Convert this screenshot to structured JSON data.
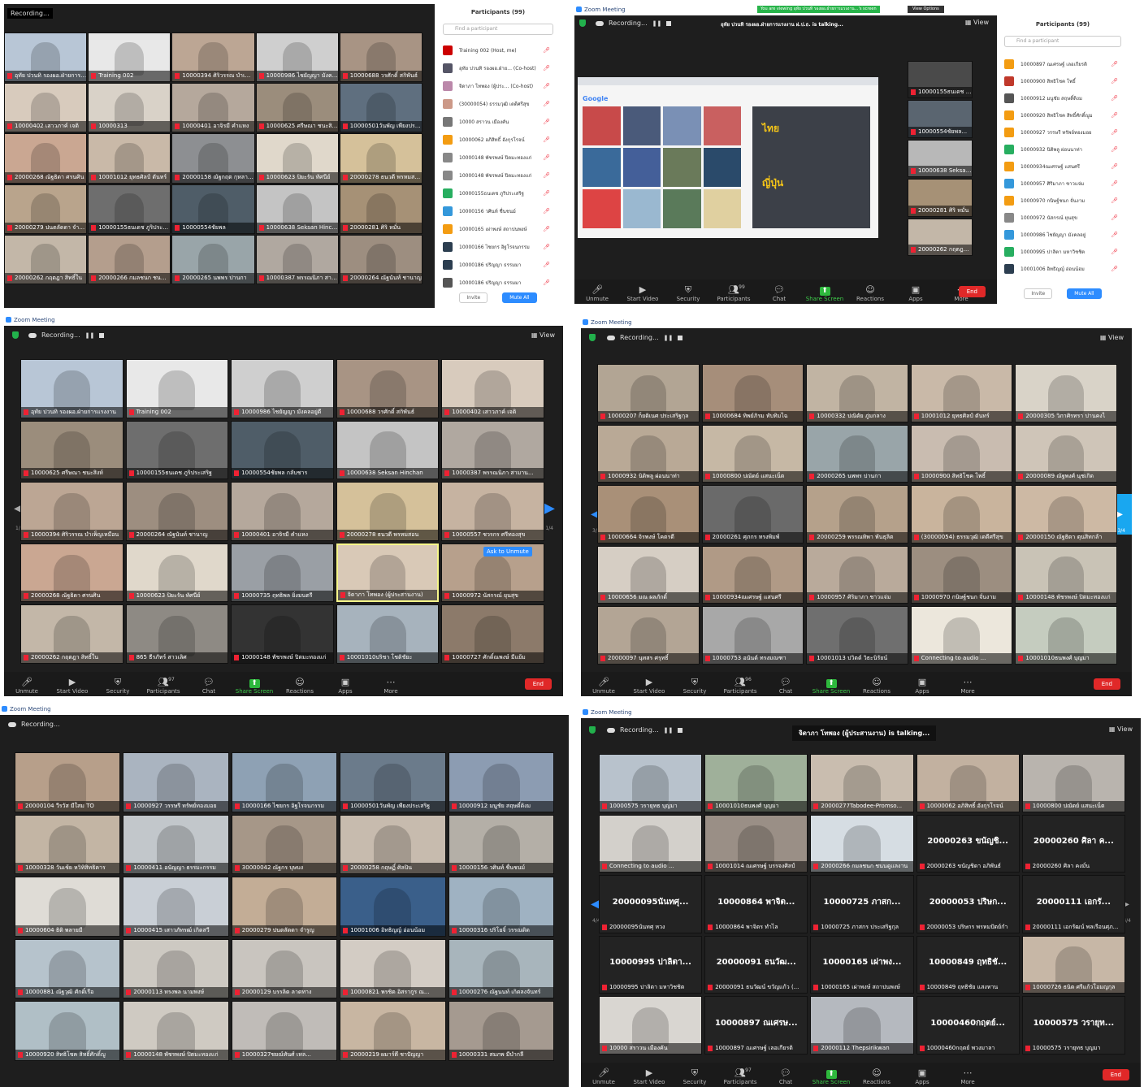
{
  "p1": {
    "recording": "Recording...",
    "participants_title": "Participants (99)",
    "search_placeholder": "Find a participant",
    "invite": "Invite",
    "mute_all": "Mute All",
    "tiles": [
      {
        "n": "อุทัย ปวนทิ รองผอ.ฝ่ายการแรงงาน",
        "c": "#b8c6d6"
      },
      {
        "n": "Training 002",
        "c": "#e8e8e8"
      },
      {
        "n": "10000394 ศิริวรรณ บำเพ็ญเหมือน",
        "c": "#bca694"
      },
      {
        "n": "10000986 ไชยัญญา มังคลอยู่ดี",
        "c": "#cfcfcf"
      },
      {
        "n": "10000688 วรศักดิ์ สกิพันธ์",
        "c": "#a89484"
      },
      {
        "n": "10000402 เสาวภาค์ เจติ",
        "c": "#d8cbbd"
      },
      {
        "n": "10000313",
        "c": "#d9d2c8"
      },
      {
        "n": "10000401 อาจิรมี คำแหง",
        "c": "#b5a89c"
      },
      {
        "n": "10000625 ศรีษณา ชนะสิงห์",
        "c": "#9b8d7c"
      },
      {
        "n": "10000501วันพัญ เพียงประเสริฐ",
        "c": "#5f6f7f"
      },
      {
        "n": "20000268 ณัฐธิดา ศรนศิน",
        "c": "#caa792"
      },
      {
        "n": "10001012 ยุทธศิลป์ ตันทร์",
        "c": "#c9b9a8"
      },
      {
        "n": "20000158 ณัฐกฤต กุหลาบทอง",
        "c": "#8d8f92"
      },
      {
        "n": "10000623 ปิยะรัน ทัศนีย์",
        "c": "#e0d8cb"
      },
      {
        "n": "20000278 ธนวดี พรหมสอน",
        "c": "#d5c19a"
      },
      {
        "n": "20000279 ปนตลัดดา จำรูญ",
        "c": "#b9a48c"
      },
      {
        "n": "10000155ธนเดช ภูริประเสริฐ",
        "c": "#6e6e6e"
      },
      {
        "n": "10000554ชัยพล",
        "c": "#4f5d68"
      },
      {
        "n": "10000638 Seksan Hinchan",
        "c": "#c4c4c4"
      },
      {
        "n": "20000281 ศิริ หมั่น",
        "c": "#a69176"
      },
      {
        "n": "20000262 กฤตฎา สิทธิ์ใน",
        "c": "#c3b7a8"
      },
      {
        "n": "20000266 กมลชนก ชนนดูแลงาน",
        "c": "#b49e8d"
      },
      {
        "n": "20000265 นพพร ปานกา",
        "c": "#99a5a9"
      },
      {
        "n": "10000387 พรรณนิภา สามาน",
        "c": "#b0a8a0"
      },
      {
        "n": "20000264 ณัฐนันท์ ชานาญ",
        "c": "#9d8e80"
      }
    ],
    "plist": [
      {
        "n": "Training 002 (Host, me)",
        "c": "#c00"
      },
      {
        "n": "อุทัย ปวนทิ รองผอ.ฝ่าย... (Co-host)",
        "c": "#556"
      },
      {
        "n": "จิดาภา โทพอง (ผู้ประ... (Co-host)",
        "c": "#b8a"
      },
      {
        "n": "(30000054) ธรรมวุฒิ เดดีศรีสุข",
        "c": "#c98"
      },
      {
        "n": "10000 สราวน เมืองคัน",
        "c": "#777"
      },
      {
        "n": "10000062 อภิสิทธิ์ อังกุรโรจน์",
        "c": "#f39c12"
      },
      {
        "n": "10000148 พัชรพงษ์ ปิตมะทองแก่",
        "c": "#888"
      },
      {
        "n": "10000148 พัชรพงษ์ ปิตมะทองแก่",
        "c": "#888"
      },
      {
        "n": "10000155ธนเดช ภูริประเสริฐ",
        "c": "#27ae60"
      },
      {
        "n": "10000156 วศินท์ ชื่นชนม์",
        "c": "#3498db"
      },
      {
        "n": "10000165 เผ่าพงษ์ สถาปนพงษ์",
        "c": "#f39c12"
      },
      {
        "n": "10000166 ไชยกร อิฐโรจนกรรม",
        "c": "#2c3e50"
      },
      {
        "n": "10000186 ปริญญา ธรรมมา",
        "c": "#2c3e50"
      },
      {
        "n": "10000186 ปริญญา ธรรมมา",
        "c": "#555"
      }
    ]
  },
  "p2": {
    "title": "Zoom Meeting",
    "banner": "You are viewing อุทัย ปวนทิ รองผอ.ฝ่ายการแรงงาน...'s screen",
    "view_options": "View Options",
    "talking": "อุทัย ปวนทิ รองผอ.ฝ่ายการแรงงาน ฝ.ป.ธ. is talking...",
    "recording": "Recording...",
    "participants_title": "Participants (99)",
    "search_placeholder": "Find a participant",
    "invite": "Invite",
    "mute_all": "Mute All",
    "view": "View",
    "google": "Google",
    "thai_label": "ไทย",
    "japan_label": "ญี่ปุ่น",
    "side_tiles": [
      {
        "n": "10000155ธนเดช ภูริ...",
        "c": "#4a4a4a"
      },
      {
        "n": "10000554ชัยพล...",
        "c": "#5a6570"
      },
      {
        "n": "10000638 Seksan Hin...",
        "c": "#b8b8b8"
      },
      {
        "n": "20000281 ศิริ หมั่น",
        "c": "#a69176"
      },
      {
        "n": "20000262 กฤตฎา สิทธิ์",
        "c": "#c3b7a8"
      }
    ],
    "plist": [
      {
        "n": "10000897 ณเศรษฐ์ เลอเกียรติ",
        "c": "#f39c12"
      },
      {
        "n": "10000900 สิทธิโชค โพธิ์",
        "c": "#c0392b"
      },
      {
        "n": "10000912 มนูชัย สฤษดิ์ดิงม",
        "c": "#555"
      },
      {
        "n": "10000920 สิทธิโชค สิทธิ์ศักดิ์ญูม",
        "c": "#f39c12"
      },
      {
        "n": "10000927 วรรษรี ทรัพย์ทองมอย",
        "c": "#f39c12"
      },
      {
        "n": "10000932 นิติพลู ผ่อนนาท่า",
        "c": "#27ae60"
      },
      {
        "n": "10000934ณเศรษฐ์ แสนศรี",
        "c": "#f39c12"
      },
      {
        "n": "10000957 ศิริมาภา ชาวแจ่ม",
        "c": "#3498db"
      },
      {
        "n": "10000970 กนิษฐ์ชนก จั่นงาม",
        "c": "#f39c12"
      },
      {
        "n": "10000972 นัสกรณ์ ยุนสุข",
        "c": "#888"
      },
      {
        "n": "10000986 ไชยัญญา มังคลอยู่",
        "c": "#3498db"
      },
      {
        "n": "10000995 ปาลิตา มหาวิชชิต",
        "c": "#27ae60"
      },
      {
        "n": "10001006 อิทธิญญ์ อ่อนน้อม",
        "c": "#2c3e50"
      }
    ],
    "controls": [
      "Unmute",
      "Start Video",
      "Security",
      "Participants",
      "Chat",
      "Share Screen",
      "Reactions",
      "Apps",
      "More"
    ],
    "count": "99",
    "end": "End"
  },
  "p3": {
    "title": "Zoom Meeting",
    "recording": "Recording...",
    "view": "View",
    "page": "1/4",
    "page_r": "1/4",
    "ask_unmute": "Ask to Unmute",
    "count": "97",
    "end": "End",
    "controls": [
      "Unmute",
      "Start Video",
      "Security",
      "Participants",
      "Chat",
      "Share Screen",
      "Reactions",
      "Apps",
      "More"
    ],
    "tiles": [
      {
        "n": "อุทัย ปวนทิ รองผอ.ฝ่ายการแรงงาน",
        "c": "#b8c6d6"
      },
      {
        "n": "Training 002",
        "c": "#e8e8e8"
      },
      {
        "n": "10000986 ไชยัญญา มังคลอยู่ดี",
        "c": "#cfcfcf"
      },
      {
        "n": "10000688 วรศักดิ์ สกิพันธ์",
        "c": "#a89484"
      },
      {
        "n": "10000402 เสาวภาค์ เจติ",
        "c": "#d8cbbd"
      },
      {
        "n": "10000625 ศรีษณา ชนะสิงห์",
        "c": "#9b8d7c"
      },
      {
        "n": "10000155ธนเดช ภูริประเสริฐ",
        "c": "#6e6e6e"
      },
      {
        "n": "10000554ชัยพล กลับชาร",
        "c": "#4f5d68"
      },
      {
        "n": "10000638 Seksan Hinchan",
        "c": "#c4c4c4"
      },
      {
        "n": "10000387 พรรณนิภา สามาน...",
        "c": "#b0a8a0"
      },
      {
        "n": "10000394 ศิริวรรณ บำเพ็ญเหมือน",
        "c": "#bca694"
      },
      {
        "n": "20000264 ณัฐนันท์ ชานาญ",
        "c": "#9d8e80"
      },
      {
        "n": "10000401 อาจิรมี คำแหง",
        "c": "#b5a89c"
      },
      {
        "n": "20000278 ธนวดี พรหมสอน",
        "c": "#d5c19a"
      },
      {
        "n": "10000557 ชวรกร ศรีทองสุข",
        "c": "#c6b3a1"
      },
      {
        "n": "20000268 ณัฐธิดา ศรนศิน",
        "c": "#caa792"
      },
      {
        "n": "10000623 ปิยะรัน ทัศนีย์",
        "c": "#e0d8cb"
      },
      {
        "n": "10000735 ฤทธิพล ยิ่งมนตรี",
        "c": "#9a9fa5"
      },
      {
        "n": "จิดาภา โทพอง (ผู้ประสานงาน)",
        "c": "#d9c9b7",
        "hl": true
      },
      {
        "n": "10000972 นัสกรณ์ ยุนสุข",
        "c": "#b7a08c"
      },
      {
        "n": "20000262 กฤตฎา สิทธิ์ใน",
        "c": "#c3b7a8"
      },
      {
        "n": "865 ธีรภัทร์ สาวเลิศ",
        "c": "#8e8a84"
      },
      {
        "n": "10000148 พัชรพงษ์ ปิตมะทองแก่",
        "c": "#333"
      },
      {
        "n": "10001010ปริชา โชติชัยะ",
        "c": "#a7b3bd"
      },
      {
        "n": "10000727 ศักดิ์ณพงษ์ มีแย้ม",
        "c": "#8c7a6a"
      }
    ]
  },
  "p4": {
    "title": "Zoom Meeting",
    "recording": "Recording...",
    "view": "View",
    "page": "3/4",
    "page_r": "3/4",
    "count": "96",
    "end": "End",
    "controls": [
      "Unmute",
      "Start Video",
      "Security",
      "Participants",
      "Chat",
      "Share Screen",
      "Reactions",
      "Apps",
      "More"
    ],
    "tiles": [
      {
        "n": "10000207 ก็ยติเนศ ประเสริฐกุล",
        "c": "#b2a594"
      },
      {
        "n": "10000684 ทิพย์ภิรม ทับทิมไฉ",
        "c": "#a68e7a"
      },
      {
        "n": "10000332 ปณิดัย ภู่มกลาง",
        "c": "#c1b4a3"
      },
      {
        "n": "10001012 ยุทธศิลป์ ตันทร์",
        "c": "#c9b9a8"
      },
      {
        "n": "20000305 วิภาศิรทรา ปานคงไ",
        "c": "#d9d3c8"
      },
      {
        "n": "10000932 นิติพลู ผ่อนนาท่า",
        "c": "#b9a996"
      },
      {
        "n": "10000800 ปณัดย์ แสนะเน็ต",
        "c": "#c6b8a5"
      },
      {
        "n": "20000265 นพพร ปานกา",
        "c": "#99a5a9"
      },
      {
        "n": "10000900 สิทธิโชค โพธิ์",
        "c": "#c9bcb0"
      },
      {
        "n": "20000089 ณัฐพงศ์ นุชเกิด",
        "c": "#cfc5b8"
      },
      {
        "n": "10000664 จิรพงษ์ โคตรดี",
        "c": "#a99078"
      },
      {
        "n": "20000261 ศุภกร ทรงพิมพ์",
        "c": "#6a6a6a"
      },
      {
        "n": "20000259 พรรณทิพา พันธุลิต",
        "c": "#b5a18b"
      },
      {
        "n": "(30000054) ธรรมวุฒิ เดดีศรีสุข",
        "c": "#c9b49d"
      },
      {
        "n": "20000150 ณัฐธิดา ตุนสิทกล้า",
        "c": "#cdb9a4"
      },
      {
        "n": "10000656 มณ ผลภักดิ์",
        "c": "#d6cec4"
      },
      {
        "n": "10000934ณเศรษฐ์ แสนศรี",
        "c": "#b09a86"
      },
      {
        "n": "10000957 ศิริมาภา ชาวแจ่ม",
        "c": "#b9aa9b"
      },
      {
        "n": "10000970 กนิษฐ์ชนก จั่นงาม",
        "c": "#9c8e80"
      },
      {
        "n": "10000148 พัชรพงษ์ ปิตมะทองแก่",
        "c": "#c9c3b6"
      },
      {
        "n": "20000097 นุทสร ศรุทธิ์",
        "c": "#b3a595"
      },
      {
        "n": "10000753 อนันต์ ทรงมณฑา",
        "c": "#a8a8a8"
      },
      {
        "n": "10001013 ปวิตต์ วิธะนิรัยน์",
        "c": "#6f6f6f"
      },
      {
        "n": "Connecting to audio ...",
        "c": "#ece7dc"
      },
      {
        "n": "10001010ธนพงศ์ บุญมา",
        "c": "#c5ccbf"
      }
    ]
  },
  "p5": {
    "title": "Zoom Meeting",
    "recording": "Recording...",
    "tiles": [
      {
        "n": "20000104 วีรวัส มีใสม TO",
        "c": "#b79f8a"
      },
      {
        "n": "10000927 วรรษรี ทรัพย์ทองมอย",
        "c": "#aab4c0"
      },
      {
        "n": "10000166 ไชยกร อิฐโรจนกรรม",
        "c": "#8ea1b4"
      },
      {
        "n": "10000501วันพัญ เพียงประเสริฐ",
        "c": "#6b7b8b"
      },
      {
        "n": "10000912 มนูชัย สฤษดิ์ดิงม",
        "c": "#8c9cb2"
      },
      {
        "n": "10000328 วันเช้ย หวิทิสิทธิคาร",
        "c": "#c3b5a4"
      },
      {
        "n": "10000411 อนัญญา ธรรมะกรรม",
        "c": "#c2c7cb"
      },
      {
        "n": "30000042 ณัฐกร บุษบง",
        "c": "#a69788"
      },
      {
        "n": "20000258 กฤษฏิ์ ศิลปิน",
        "c": "#c7bbae"
      },
      {
        "n": "10000156 วศินท์ ชื่นชนม์",
        "c": "#b4afa7"
      },
      {
        "n": "10000604 ธิติ พลายมี",
        "c": "#dfdcd6"
      },
      {
        "n": "10000415 เสาวภัทรฒ์ เกิดสวี",
        "c": "#c9cfd6"
      },
      {
        "n": "20000279 ปนตลัดดา จำรูญ",
        "c": "#c3ad96"
      },
      {
        "n": "10001006 อิทธิญญ์ อ่อนน้อม",
        "c": "#3a5f8a"
      },
      {
        "n": "10000316 ปริโยจิ์ วรรณดิด",
        "c": "#9fb2c2"
      },
      {
        "n": "10000881 ณัฐวุฒิ ศักดิ์เรือ",
        "c": "#b6c3cc"
      },
      {
        "n": "20000113 ทรงพล นามพงษ์",
        "c": "#cdc9c2"
      },
      {
        "n": "20000129 บรรลิต ลาดทาง",
        "c": "#c9c5bf"
      },
      {
        "n": "10000821 พรชิต อิสรากูร ณ...",
        "c": "#d3ccc4"
      },
      {
        "n": "10000276 ณัฐนนท์ เกิดลงจันทร์",
        "c": "#a8b5bc"
      },
      {
        "n": "10000920 สิทธิโชค สิทธิ์ศักดิ์ญู",
        "c": "#b0bfc6"
      },
      {
        "n": "10000148 พัชรพงษ์ ปิตมะทองแก่",
        "c": "#cfcac2"
      },
      {
        "n": "10000327ชยณ์ทันศ์ เหล...",
        "c": "#c0bcb8"
      },
      {
        "n": "20000219 ผมาร์ตึ ชาปัญญา",
        "c": "#c8b6a2"
      },
      {
        "n": "10000331 สมภพ มีบำกลี",
        "c": "#a59a90"
      }
    ]
  },
  "p6": {
    "title": "Zoom Meeting",
    "recording": "Recording...",
    "talking": "จิดาภา โทพอง (ผู้ประสานงาน) is talking...",
    "view": "View",
    "page": "4/4",
    "page_r": "4/4",
    "count": "97",
    "end": "End",
    "controls": [
      "Unmute",
      "Start Video",
      "Security",
      "Participants",
      "Chat",
      "Share Screen",
      "Reactions",
      "Apps",
      "More"
    ],
    "tiles": [
      {
        "n": "10000575 วรายุทธ บุญมา",
        "c": "#b8c2cc",
        "v": 1
      },
      {
        "n": "10001010ธนพงศ์ บุญมา",
        "c": "#9fb09a",
        "v": 1
      },
      {
        "n": "20000277Tabodee-Promso...",
        "c": "#c9bdaf",
        "v": 1
      },
      {
        "n": "10000062 อภิสิทธิ์ อังกุรโรจน์",
        "c": "#c2b1a0",
        "v": 1
      },
      {
        "n": "10000800 ปณัดย์ แสนะเน็ต",
        "c": "#b9b4ae",
        "v": 1
      },
      {
        "n": "Connecting to audio ...",
        "c": "#d3d0cb",
        "v": 1
      },
      {
        "n": "10001014 ณเศรษฐ์ บรรจงศิลป์",
        "c": "#9a8f86",
        "v": 1
      },
      {
        "n": "20000266 กมลชนก ชนนดูแลงาน",
        "c": "#d6dde3",
        "v": 1
      },
      {
        "n": "20000263 ขนัญชิดา อภิพันธ์",
        "big": "20000263 ขนัญชิ...",
        "v": 0
      },
      {
        "n": "20000260 ศิลา คงมั่น",
        "big": "20000260 ศิลา ค...",
        "v": 0
      },
      {
        "n": "20000095นันทศุ หวง",
        "big": "20000095นันทศุ...",
        "v": 0
      },
      {
        "n": "10000864 พาจิตร ทำไล",
        "big": "10000864 พาจิต...",
        "v": 0
      },
      {
        "n": "10000725 ภาสกร ประเสริฐกุล",
        "big": "10000725 ภาสก...",
        "v": 0
      },
      {
        "n": "20000053 ปริษกร พรหมปัตย์กำ",
        "big": "20000053 ปริษก...",
        "v": 0
      },
      {
        "n": "20000111 เอกรัฒน์ พลเรือนศุภ...",
        "big": "20000111 เอกรั...",
        "v": 0
      },
      {
        "n": "10000995 ปาลิตา มหาวิชชิต",
        "big": "10000995 ปาลิตา...",
        "v": 0
      },
      {
        "n": "20000091 ธนวัฒน์ ขวัญแก้ว (...",
        "big": "20000091 ธนวัฒ...",
        "v": 0
      },
      {
        "n": "10000165 เผ่าพงษ์ สถาปนพงษ์",
        "big": "10000165 เผ่าพง...",
        "v": 0
      },
      {
        "n": "10000849 ฤทธิชัย แสงทาน",
        "big": "10000849 ฤทธิชั...",
        "v": 0
      },
      {
        "n": "10000726 ธนิต ศรีแก้วโอมญกุล",
        "c": "#c7b7a6",
        "v": 1
      },
      {
        "n": "10000 สราวน เมืองคัน",
        "c": "#d9d6d1",
        "v": 1
      },
      {
        "n": "10000897 ณเศรษฐ์ เลอเกียรติ",
        "big": "10000897 ณเศรษ...",
        "v": 0
      },
      {
        "n": "20000112 Thepsirikwan",
        "c": "#b5b9bf",
        "v": 1
      },
      {
        "n": "10000460กฤตย์ พวงมาลา",
        "big": "10000460กฤตย์...",
        "v": 0
      },
      {
        "n": "10000575 วรายุทธ บุญมา",
        "big": "10000575 วรายุท...",
        "v": 0
      }
    ]
  }
}
